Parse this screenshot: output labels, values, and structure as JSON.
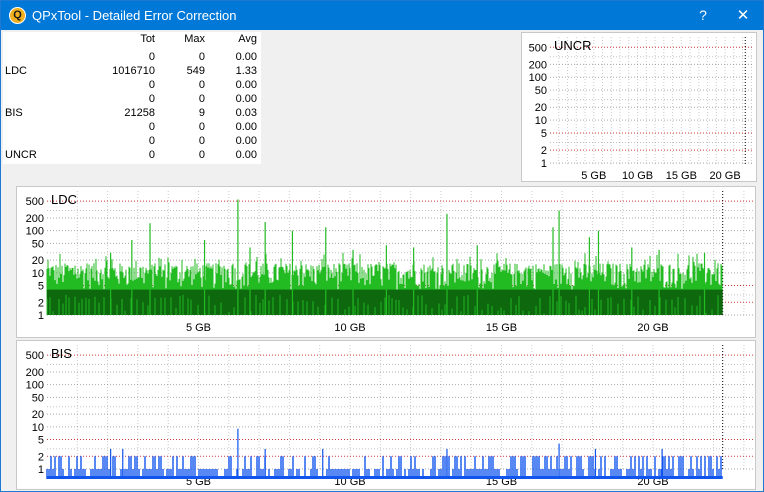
{
  "window": {
    "title": "QPxTool - Detailed Error Correction",
    "app_icon_glyph": "Q",
    "help_label": "?",
    "close_label": "✕"
  },
  "stats": {
    "headers": {
      "tot": "Tot",
      "max": "Max",
      "avg": "Avg"
    },
    "rows": [
      {
        "label": "",
        "tot": "0",
        "max": "0",
        "avg": "0.00"
      },
      {
        "label": "LDC",
        "tot": "1016710",
        "max": "549",
        "avg": "1.33"
      },
      {
        "label": "",
        "tot": "0",
        "max": "0",
        "avg": "0.00"
      },
      {
        "label": "",
        "tot": "0",
        "max": "0",
        "avg": "0.00"
      },
      {
        "label": "BIS",
        "tot": "21258",
        "max": "9",
        "avg": "0.03"
      },
      {
        "label": "",
        "tot": "0",
        "max": "0",
        "avg": "0.00"
      },
      {
        "label": "",
        "tot": "0",
        "max": "0",
        "avg": "0.00"
      },
      {
        "label": "UNCR",
        "tot": "0",
        "max": "0",
        "avg": "0.00"
      }
    ]
  },
  "colors": {
    "titlebar": "#0078d7",
    "ldc_light": "#22bb22",
    "ldc_dark": "#0a5a0a",
    "bis_bar": "#1155ee",
    "red_grid": "#cc2222",
    "black_grid": "#555555"
  },
  "chart_data": [
    {
      "type": "bar",
      "title": "UNCR",
      "y_scale": "log",
      "y_ticks": [
        "500",
        "200",
        "100",
        "50",
        "20",
        "10",
        "5",
        "2",
        "1"
      ],
      "x_ticks": [
        "5 GB",
        "10 GB",
        "15 GB",
        "20 GB"
      ],
      "x_unit": "GB",
      "x_range": [
        0,
        23.3
      ],
      "disc_end_gb": 22.3,
      "grid": true,
      "values": []
    },
    {
      "type": "bar",
      "title": "LDC",
      "y_scale": "log",
      "y_ticks": [
        "500",
        "200",
        "100",
        "50",
        "20",
        "10",
        "5",
        "2",
        "1"
      ],
      "x_ticks": [
        "5 GB",
        "10 GB",
        "15 GB",
        "20 GB"
      ],
      "x_unit": "GB",
      "x_range": [
        0,
        23.3
      ],
      "disc_end_gb": 22.3,
      "grid": true,
      "typical_range": [
        4,
        30
      ],
      "dark_band_level": 4,
      "spikes": [
        {
          "x": 2.1,
          "y": 30
        },
        {
          "x": 2.8,
          "y": 60
        },
        {
          "x": 3.4,
          "y": 150
        },
        {
          "x": 5.2,
          "y": 60
        },
        {
          "x": 6.3,
          "y": 549
        },
        {
          "x": 6.7,
          "y": 40
        },
        {
          "x": 7.2,
          "y": 160
        },
        {
          "x": 8.1,
          "y": 100
        },
        {
          "x": 9.2,
          "y": 120
        },
        {
          "x": 10.1,
          "y": 35
        },
        {
          "x": 11.2,
          "y": 45
        },
        {
          "x": 12.1,
          "y": 40
        },
        {
          "x": 13.2,
          "y": 250
        },
        {
          "x": 14.2,
          "y": 45
        },
        {
          "x": 16.7,
          "y": 120
        },
        {
          "x": 16.9,
          "y": 300
        },
        {
          "x": 17.9,
          "y": 70
        },
        {
          "x": 18.2,
          "y": 100
        },
        {
          "x": 19.3,
          "y": 40
        },
        {
          "x": 20.2,
          "y": 35
        },
        {
          "x": 21.7,
          "y": 30
        }
      ]
    },
    {
      "type": "bar",
      "title": "BIS",
      "y_scale": "log",
      "y_ticks": [
        "500",
        "200",
        "100",
        "50",
        "20",
        "10",
        "5",
        "2",
        "1"
      ],
      "x_ticks": [
        "5 GB",
        "10 GB",
        "15 GB",
        "20 GB"
      ],
      "x_unit": "GB",
      "x_range": [
        0,
        23.3
      ],
      "disc_end_gb": 22.3,
      "grid": true,
      "typical_range": [
        1,
        2
      ],
      "spikes": [
        {
          "x": 2.1,
          "y": 3
        },
        {
          "x": 2.5,
          "y": 3
        },
        {
          "x": 6.3,
          "y": 9
        },
        {
          "x": 7.2,
          "y": 3
        },
        {
          "x": 9.1,
          "y": 3
        },
        {
          "x": 13.2,
          "y": 3
        },
        {
          "x": 16.9,
          "y": 4
        },
        {
          "x": 18.1,
          "y": 3
        },
        {
          "x": 20.3,
          "y": 3
        }
      ]
    }
  ]
}
